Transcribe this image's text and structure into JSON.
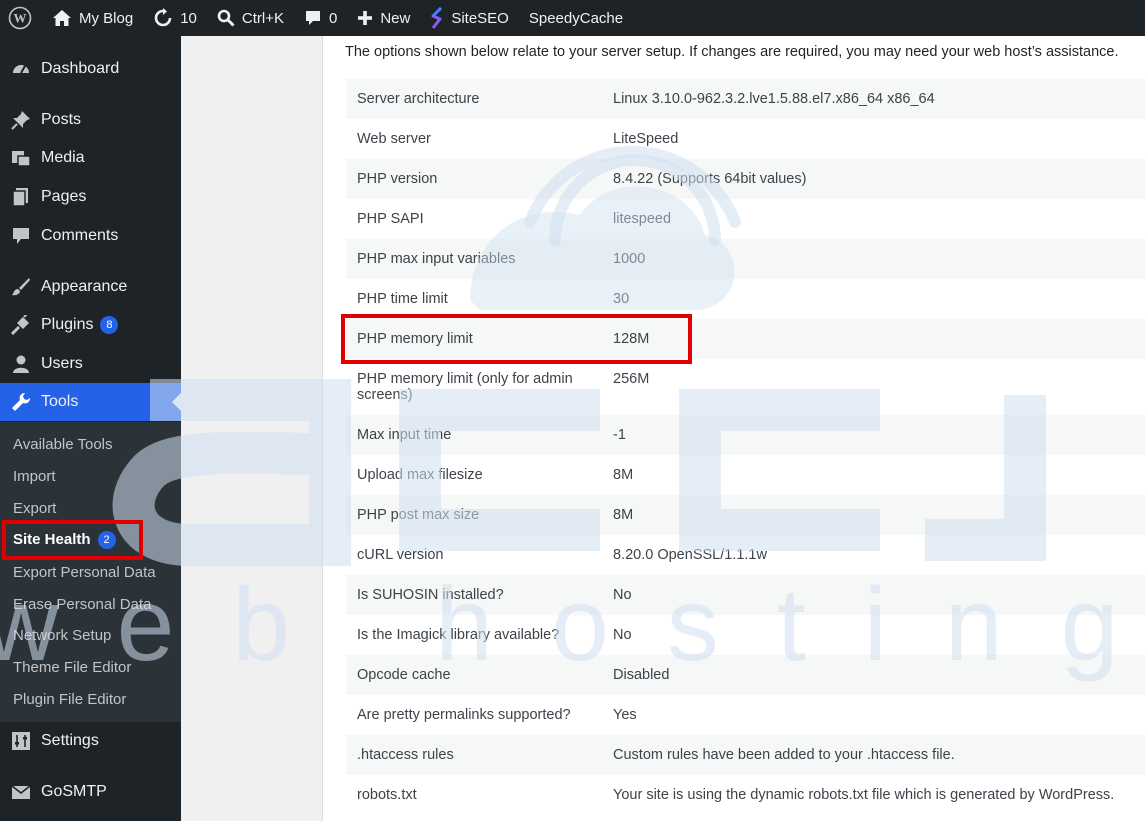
{
  "admin_bar": {
    "site_name": "My Blog",
    "updates_count": "10",
    "shortcut": "Ctrl+K",
    "comments_count": "0",
    "new_label": "New",
    "siteseo_label": "SiteSEO",
    "speedycache_label": "SpeedyCache"
  },
  "sidebar": {
    "items": [
      {
        "label": "Dashboard",
        "icon": "dashboard-icon"
      },
      {
        "label": "Posts",
        "icon": "pin-icon"
      },
      {
        "label": "Media",
        "icon": "media-icon"
      },
      {
        "label": "Pages",
        "icon": "pages-icon"
      },
      {
        "label": "Comments",
        "icon": "comment-icon"
      },
      {
        "label": "Appearance",
        "icon": "brush-icon"
      },
      {
        "label": "Plugins",
        "icon": "plug-icon",
        "badge": "8"
      },
      {
        "label": "Users",
        "icon": "user-icon"
      },
      {
        "label": "Tools",
        "icon": "wrench-icon"
      },
      {
        "label": "Settings",
        "icon": "sliders-icon"
      },
      {
        "label": "GoSMTP",
        "icon": "mail-icon"
      }
    ],
    "tools_submenu": [
      {
        "label": "Available Tools"
      },
      {
        "label": "Import"
      },
      {
        "label": "Export"
      },
      {
        "label": "Site Health",
        "badge": "2"
      },
      {
        "label": "Export Personal Data"
      },
      {
        "label": "Erase Personal Data"
      },
      {
        "label": "Network Setup"
      },
      {
        "label": "Theme File Editor"
      },
      {
        "label": "Plugin File Editor"
      }
    ]
  },
  "main": {
    "intro": "The options shown below relate to your server setup. If changes are required, you may need your web host’s assistance.",
    "rows": [
      {
        "label": "Server architecture",
        "value": "Linux 3.10.0-962.3.2.lve1.5.88.el7.x86_64 x86_64"
      },
      {
        "label": "Web server",
        "value": "LiteSpeed"
      },
      {
        "label": "PHP version",
        "value": "8.4.22 (Supports 64bit values)"
      },
      {
        "label": "PHP SAPI",
        "value": "litespeed"
      },
      {
        "label": "PHP max input variables",
        "value": "1000"
      },
      {
        "label": "PHP time limit",
        "value": "30"
      },
      {
        "label": "PHP memory limit",
        "value": "128M"
      },
      {
        "label": "PHP memory limit (only for admin screens)",
        "value": "256M"
      },
      {
        "label": "Max input time",
        "value": "-1"
      },
      {
        "label": "Upload max filesize",
        "value": "8M"
      },
      {
        "label": "PHP post max size",
        "value": "8M"
      },
      {
        "label": "cURL version",
        "value": "8.20.0 OpenSSL/1.1.1w"
      },
      {
        "label": "Is SUHOSIN installed?",
        "value": "No"
      },
      {
        "label": "Is the Imagick library available?",
        "value": "No"
      },
      {
        "label": "Opcode cache",
        "value": "Disabled"
      },
      {
        "label": "Are pretty permalinks supported?",
        "value": "Yes"
      },
      {
        "label": ".htaccess rules",
        "value": "Custom rules have been added to your .htaccess file."
      },
      {
        "label": "robots.txt",
        "value": "Your site is using the dynamic robots.txt file which is generated by WordPress."
      }
    ]
  },
  "watermark": {
    "line1": "accu",
    "line2": "web hosting"
  },
  "colors": {
    "admin_bg": "#1d2327",
    "accent": "#2463e8",
    "highlight": "#e00000"
  }
}
